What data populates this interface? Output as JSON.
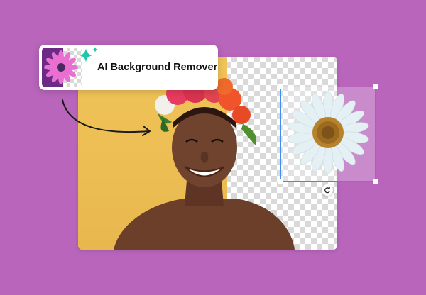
{
  "feature_card": {
    "title": "AI Background Remover",
    "icon": "sparkle-icon",
    "thumbnail": "pink-flower-thumbnail"
  },
  "editor": {
    "image": "woman-with-flower-crown",
    "selected_sticker": "daisy-flower",
    "rotate_icon": "rotate-icon"
  },
  "colors": {
    "background": "#b865bb",
    "accent_sparkle": "#22c7a9",
    "selection_blue": "#3d8ef0",
    "backdrop_yellow": "#f0c458"
  }
}
